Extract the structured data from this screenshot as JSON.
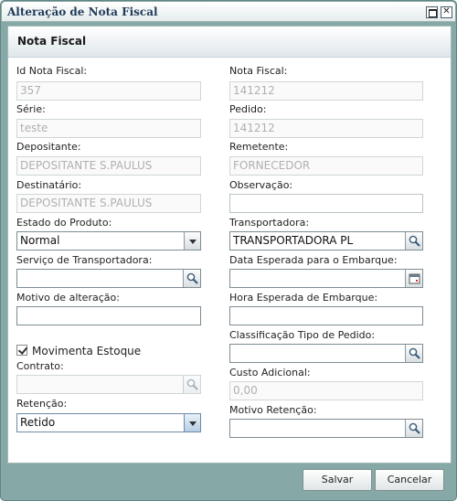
{
  "window": {
    "title": "Alteração de Nota Fiscal",
    "close_glyph": "✕"
  },
  "section": {
    "title": "Nota Fiscal"
  },
  "left": {
    "id_label": "Id Nota Fiscal:",
    "id_value": "357",
    "serie_label": "Série:",
    "serie_value": "teste",
    "depositante_label": "Depositante:",
    "depositante_value": "DEPOSITANTE S.PAULUS",
    "destinatario_label": "Destinatário:",
    "destinatario_value": "DEPOSITANTE S.PAULUS",
    "estado_label": "Estado do Produto:",
    "estado_value": "Normal",
    "servico_label": "Serviço de Transportadora:",
    "servico_value": "",
    "motivo_label": "Motivo de alteração:",
    "motivo_value": "",
    "movimenta_label": "Movimenta Estoque",
    "movimenta_checked": true,
    "contrato_label": "Contrato:",
    "contrato_value": "",
    "retencao_label": "Retenção:",
    "retencao_value": "Retido"
  },
  "right": {
    "nota_label": "Nota Fiscal:",
    "nota_value": "141212",
    "pedido_label": "Pedido:",
    "pedido_value": "141212",
    "remetente_label": "Remetente:",
    "remetente_value": "FORNECEDOR",
    "observacao_label": "Observação:",
    "observacao_value": "",
    "transportadora_label": "Transportadora:",
    "transportadora_value": "TRANSPORTADORA PL",
    "data_label": "Data Esperada para o Embarque:",
    "data_value": "",
    "hora_label": "Hora Esperada de Embarque:",
    "hora_value": "",
    "classificacao_label": "Classificação Tipo de Pedido:",
    "classificacao_value": "",
    "custo_label": "Custo Adicional:",
    "custo_value": "0,00",
    "motivo_ret_label": "Motivo Retenção:",
    "motivo_ret_value": ""
  },
  "footer": {
    "save_label": "Salvar",
    "cancel_label": "Cancelar"
  },
  "icons": {
    "search": "search-icon",
    "calendar": "calendar-icon",
    "dropdown": "chevron-down-icon"
  }
}
